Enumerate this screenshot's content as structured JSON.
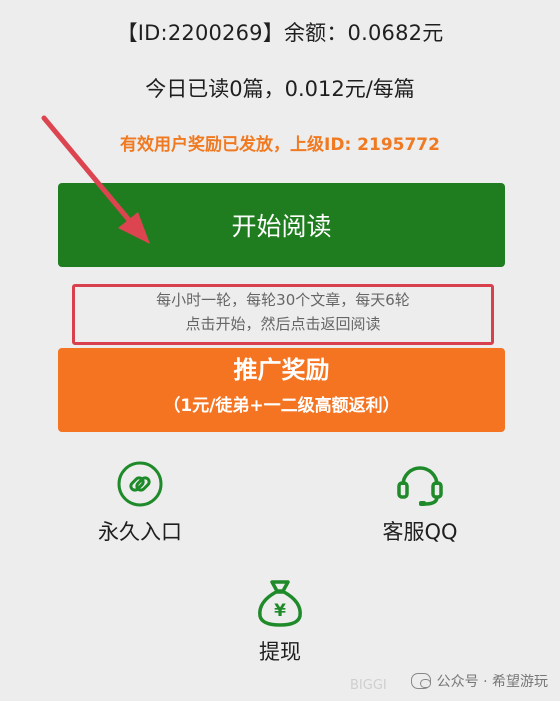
{
  "header": {
    "account_line": "【ID:2200269】余额：0.0682元",
    "today_line": "今日已读0篇，0.012元/每篇",
    "notice": "有效用户奖励已发放，上级ID: 2195772"
  },
  "read_button": {
    "label": "开始阅读"
  },
  "rules": {
    "line1": "每小时一轮，每轮30个文章，每天6轮",
    "line2": "点击开始，然后点击返回阅读"
  },
  "promo_button": {
    "title": "推广奖励",
    "subtitle": "（1元/徒弟+一二级高额返利）"
  },
  "tiles": {
    "permanent_entry": {
      "label": "永久入口",
      "icon": "link-icon"
    },
    "customer_service": {
      "label": "客服QQ",
      "icon": "headset-icon"
    },
    "withdraw": {
      "label": "提现",
      "icon": "money-bag-icon"
    }
  },
  "watermark": {
    "text": "公众号 · 希望游玩",
    "faint": "BIGGI"
  },
  "colors": {
    "green": "#1f7d1f",
    "orange": "#f47421",
    "notice_orange": "#f07a22",
    "highlight_red": "#d9404d",
    "background": "#ededed"
  }
}
